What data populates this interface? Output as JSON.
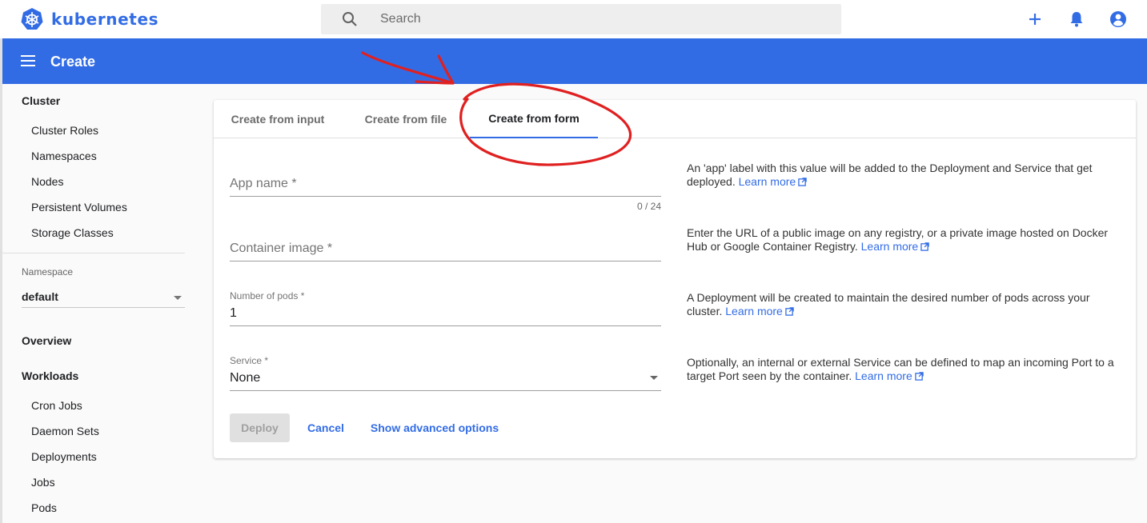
{
  "app": {
    "brand": "kubernetes",
    "accent_color": "#326ce5"
  },
  "search": {
    "placeholder": "Search"
  },
  "topbar": {
    "icons": [
      "add-icon",
      "notifications-icon",
      "account-icon"
    ]
  },
  "header": {
    "title": "Create"
  },
  "sidebar": {
    "cluster_heading": "Cluster",
    "cluster_items": [
      "Cluster Roles",
      "Namespaces",
      "Nodes",
      "Persistent Volumes",
      "Storage Classes"
    ],
    "namespace_label": "Namespace",
    "namespace_value": "default",
    "overview": "Overview",
    "workloads_heading": "Workloads",
    "workload_items": [
      "Cron Jobs",
      "Daemon Sets",
      "Deployments",
      "Jobs",
      "Pods"
    ]
  },
  "tabs": [
    "Create from input",
    "Create from file",
    "Create from form"
  ],
  "active_tab": "Create from form",
  "form": {
    "app_name": {
      "placeholder": "App name *",
      "counter": "0 / 24"
    },
    "container_image": {
      "placeholder": "Container image *"
    },
    "pods": {
      "label": "Number of pods *",
      "value": "1"
    },
    "service": {
      "label": "Service *",
      "value": "None"
    }
  },
  "help": {
    "app_name": "An 'app' label with this value will be added to the Deployment and Service that get deployed.",
    "container_image": "Enter the URL of a public image on any registry, or a private image hosted on Docker Hub or Google Container Registry.",
    "pods": "A Deployment will be created to maintain the desired number of pods across your cluster.",
    "service": "Optionally, an internal or external Service can be defined to map an incoming Port to a target Port seen by the container.",
    "learn_more": "Learn more"
  },
  "actions": {
    "deploy": "Deploy",
    "cancel": "Cancel",
    "advanced": "Show advanced options"
  },
  "annotation": {
    "color": "#e02020"
  }
}
